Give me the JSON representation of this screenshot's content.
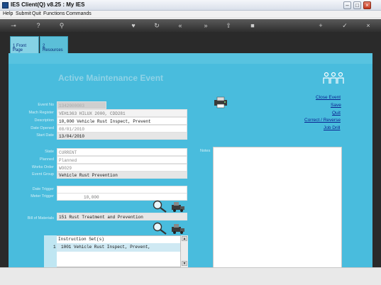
{
  "window": {
    "title": "IES Client(Q) v8.25 : My IES"
  },
  "menu": [
    "Help",
    "Submit",
    "Quit",
    "Functions",
    "Commands"
  ],
  "tabs": [
    {
      "number": "1",
      "label": "Front Page"
    },
    {
      "number": "2",
      "label": "Resources"
    }
  ],
  "page": {
    "title": "Active Maintenance Event"
  },
  "actions": [
    "Close Event",
    "Save",
    "Quit",
    "Correct / Reverse",
    "Job Drill"
  ],
  "form": {
    "event_no": {
      "label": "Event No",
      "value": "1342000003"
    },
    "mach_register": {
      "label": "Mach Register",
      "value": "VEH1363 HILUX 2000, CDD281"
    },
    "description": {
      "label": "Description",
      "value": "10,000 Vehicle Rust Inspect, Prevent"
    },
    "date_opened": {
      "label": "Date Opened",
      "value": "08/01/2010"
    },
    "start_date": {
      "label": "Start Date",
      "value": "13/04/2010"
    },
    "state": {
      "label": "State",
      "value": "CURRENT"
    },
    "planned": {
      "label": "Planned",
      "value": "Planned"
    },
    "works_order": {
      "label": "Works Order",
      "value": "WO029"
    },
    "event_group": {
      "label": "Event Group",
      "value": "Vehicle Rust Prevention"
    },
    "date_trigger": {
      "label": "Date Trigger",
      "value": ""
    },
    "meter_trigger": {
      "label": "Meter Trigger",
      "value": "10,000"
    },
    "bill_of_materials": {
      "label": "Bill of Materials",
      "value": "151 Rust Treatment and Prevention"
    }
  },
  "notes": {
    "label": "Notes",
    "value": ""
  },
  "instructions": {
    "header": "Instruction Set(s)",
    "rows": [
      {
        "num": "1",
        "text": "1001 Vehicle Rust Inspect, Prevent,"
      }
    ]
  },
  "colors": {
    "stage": "#49bcdd",
    "link": "#0a1f8f",
    "title": "#8fd2e6"
  },
  "icons": [
    "app-icon",
    "minimize-icon",
    "maximize-icon",
    "close-icon",
    "people-icon",
    "printer-icon",
    "magnifier-icon",
    "truck-icon"
  ]
}
